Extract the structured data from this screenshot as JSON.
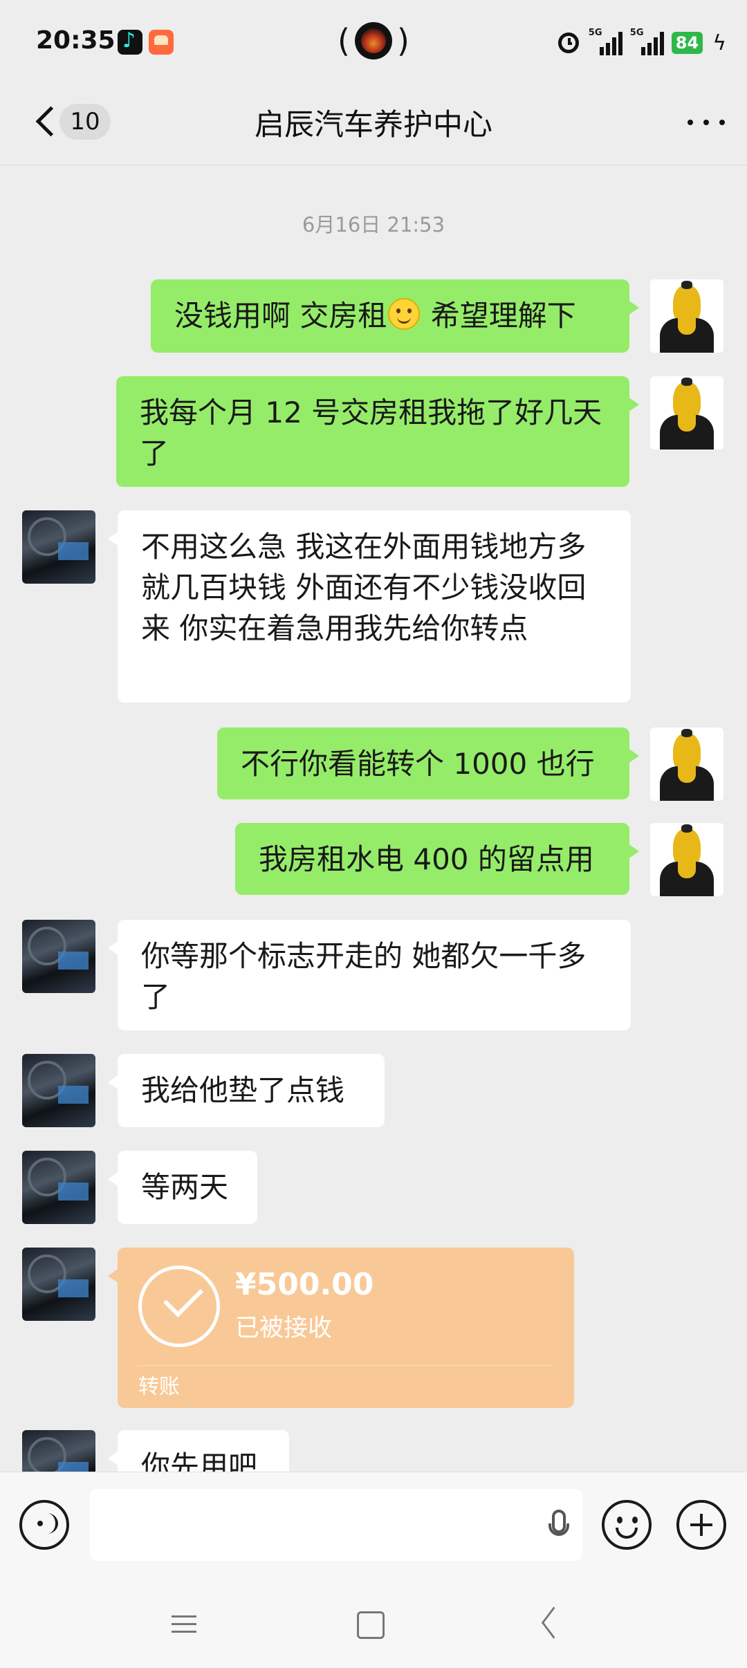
{
  "status_bar": {
    "time": "20:35",
    "network_1": "5G",
    "network_2": "5G",
    "battery": "84",
    "icons": [
      "tiktok-icon",
      "app-icon",
      "alarm-icon",
      "signal-icon",
      "battery-icon",
      "charging-icon"
    ]
  },
  "header": {
    "unread_count": "10",
    "title": "启辰汽车养护中心"
  },
  "timestamp": "6月16日 21:53",
  "messages": [
    {
      "sender": "me",
      "text_before": "没钱用啊 交房租",
      "emoji": "smile",
      "text_after": " 希望理解下"
    },
    {
      "sender": "me",
      "text": "我每个月 12 号交房租我拖了好几天了"
    },
    {
      "sender": "other",
      "text": "不用这么急 我这在外面用钱地方多 就几百块钱 外面还有不少钱没收回来 你实在着急用我先给你转点"
    },
    {
      "sender": "me",
      "text": "不行你看能转个 1000 也行"
    },
    {
      "sender": "me",
      "text": "我房租水电 400 的留点用"
    },
    {
      "sender": "other",
      "text": "你等那个标志开走的  她都欠一千多了"
    },
    {
      "sender": "other",
      "text": "我给他垫了点钱"
    },
    {
      "sender": "other",
      "text": "等两天"
    },
    {
      "sender": "other",
      "type": "transfer",
      "amount": "¥500.00",
      "status": "已被接收",
      "label": "转账"
    },
    {
      "sender": "other",
      "text": "你先用吧"
    }
  ],
  "input": {
    "placeholder": ""
  }
}
